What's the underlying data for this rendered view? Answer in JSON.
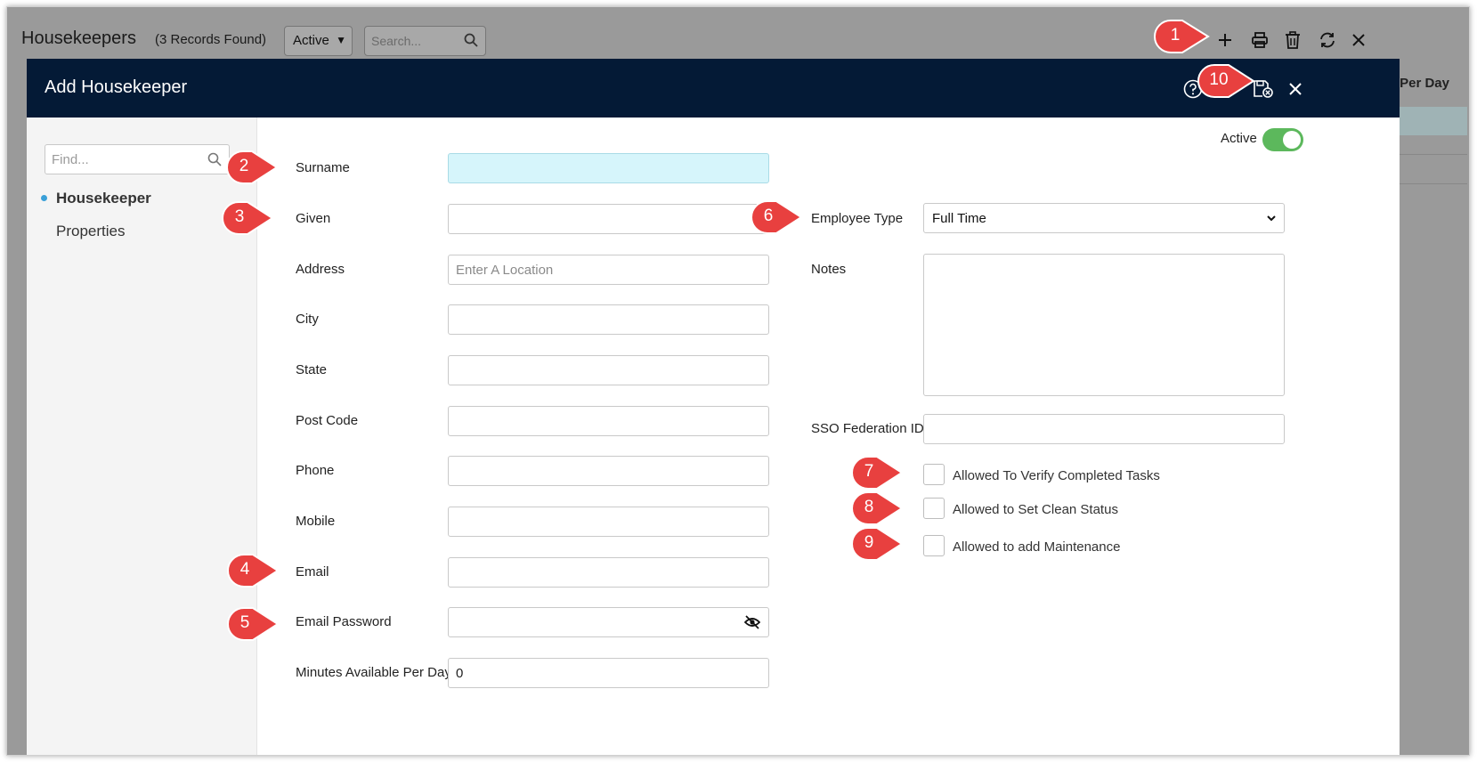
{
  "background": {
    "title": "Housekeepers",
    "record_count": "(3 Records Found)",
    "status_filter": "Active",
    "search_placeholder": "Search...",
    "column_header": "Per Day"
  },
  "modal": {
    "title": "Add Housekeeper",
    "sidebar": {
      "find_placeholder": "Find...",
      "items": [
        {
          "label": "Housekeeper",
          "active": true
        },
        {
          "label": "Properties",
          "active": false
        }
      ]
    },
    "active_label": "Active",
    "active_on": true,
    "fields": {
      "surname": {
        "label": "Surname",
        "value": ""
      },
      "given": {
        "label": "Given",
        "value": ""
      },
      "address": {
        "label": "Address",
        "placeholder": "Enter A Location"
      },
      "city": {
        "label": "City",
        "value": ""
      },
      "state": {
        "label": "State",
        "value": ""
      },
      "post_code": {
        "label": "Post Code",
        "value": ""
      },
      "phone": {
        "label": "Phone",
        "value": ""
      },
      "mobile": {
        "label": "Mobile",
        "value": ""
      },
      "email": {
        "label": "Email",
        "value": ""
      },
      "email_password": {
        "label": "Email Password",
        "value": ""
      },
      "minutes": {
        "label": "Minutes Available Per Day",
        "value": "0"
      },
      "employee_type": {
        "label": "Employee Type",
        "value": "Full Time"
      },
      "notes": {
        "label": "Notes",
        "value": ""
      },
      "sso": {
        "label": "SSO Federation ID",
        "value": ""
      }
    },
    "checkboxes": [
      {
        "label": "Allowed To Verify Completed Tasks",
        "checked": false
      },
      {
        "label": "Allowed to Set Clean Status",
        "checked": false
      },
      {
        "label": "Allowed to add Maintenance",
        "checked": false
      }
    ]
  },
  "callouts": [
    "1",
    "2",
    "3",
    "4",
    "5",
    "6",
    "7",
    "8",
    "9",
    "10"
  ],
  "colors": {
    "header_bg": "#041a36",
    "highlight_field": "#d6f5fb",
    "toggle_on": "#5cb85c",
    "callout": "#e8403f"
  }
}
